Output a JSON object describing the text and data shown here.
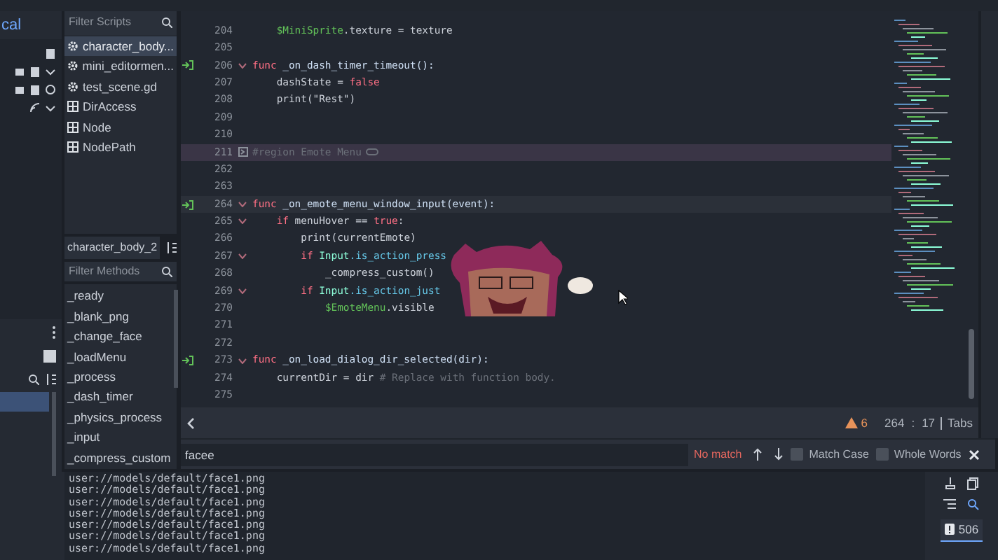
{
  "left_dock": {
    "tab": "cal"
  },
  "scripts": {
    "filter_placeholder": "Filter Scripts",
    "items": [
      {
        "name": "character_body...",
        "kind": "script",
        "selected": true
      },
      {
        "name": "mini_editormen...",
        "kind": "script",
        "selected": false
      },
      {
        "name": "test_scene.gd",
        "kind": "script",
        "selected": false
      },
      {
        "name": "DirAccess",
        "kind": "class",
        "selected": false
      },
      {
        "name": "Node",
        "kind": "class",
        "selected": false
      },
      {
        "name": "NodePath",
        "kind": "class",
        "selected": false
      }
    ]
  },
  "methods": {
    "title": "character_body_2",
    "filter_placeholder": "Filter Methods",
    "items": [
      "_ready",
      "_blank_png",
      "_change_face",
      "_loadMenu",
      "_process",
      "_dash_timer",
      "_physics_process",
      "_input",
      "_compress_custom"
    ]
  },
  "code_lines": [
    {
      "number": "204",
      "kind": "normal",
      "signal": false,
      "fold": false,
      "segments": [
        {
          "text": "\t$MiniSprite",
          "kind": "node"
        },
        {
          "text": ".texture = texture",
          "kind": "plain"
        }
      ]
    },
    {
      "number": "205",
      "kind": "normal",
      "signal": false,
      "fold": false
    },
    {
      "number": "206",
      "kind": "normal",
      "signal": true,
      "fold": true,
      "segments": [
        {
          "text": "func",
          "kind": "kw"
        },
        {
          "text": " _on_dash_timer_timeout():",
          "kind": "fn"
        }
      ]
    },
    {
      "number": "207",
      "kind": "normal",
      "signal": false,
      "fold": false,
      "segments": [
        {
          "text": "\tdashState = ",
          "kind": "plain"
        },
        {
          "text": "false",
          "kind": "kw"
        }
      ]
    },
    {
      "number": "208",
      "kind": "normal",
      "signal": false,
      "fold": false,
      "segments": [
        {
          "text": "\tprint(\"Rest\")",
          "kind": "plain"
        }
      ]
    },
    {
      "number": "209",
      "kind": "normal",
      "signal": false,
      "fold": false
    },
    {
      "number": "210",
      "kind": "normal",
      "signal": false,
      "fold": false
    },
    {
      "number": "211",
      "kind": "region",
      "signal": false,
      "fold": false,
      "segments": [
        {
          "text": "#region Emote Menu",
          "kind": "comment"
        }
      ]
    },
    {
      "number": "262",
      "kind": "normal",
      "signal": false,
      "fold": false
    },
    {
      "number": "263",
      "kind": "normal",
      "signal": false,
      "fold": false
    },
    {
      "number": "264",
      "kind": "current",
      "signal": true,
      "fold": true,
      "segments": [
        {
          "text": "func",
          "kind": "kw"
        },
        {
          "text": " _on_emote_menu_window_input(event):",
          "kind": "fn"
        }
      ]
    },
    {
      "number": "265",
      "kind": "normal",
      "signal": false,
      "fold": true,
      "segments": [
        {
          "text": "\tif",
          "kind": "kw"
        },
        {
          "text": " menuHover == ",
          "kind": "plain"
        },
        {
          "text": "true",
          "kind": "kw"
        },
        {
          "text": ":",
          "kind": "plain"
        }
      ]
    },
    {
      "number": "266",
      "kind": "normal",
      "signal": false,
      "fold": false,
      "segments": [
        {
          "text": "\t\tprint(currentEmote)",
          "kind": "plain"
        }
      ]
    },
    {
      "number": "267",
      "kind": "normal",
      "signal": false,
      "fold": true,
      "segments": [
        {
          "text": "\t\tif",
          "kind": "kw"
        },
        {
          "text": " Input",
          "kind": "cls"
        },
        {
          "text": ".is_action_press",
          "kind": "method"
        }
      ]
    },
    {
      "number": "268",
      "kind": "normal",
      "signal": false,
      "fold": false,
      "segments": [
        {
          "text": "\t\t\t_compress_custom()",
          "kind": "plain"
        }
      ]
    },
    {
      "number": "269",
      "kind": "normal",
      "signal": false,
      "fold": true,
      "segments": [
        {
          "text": "\t\tif",
          "kind": "kw"
        },
        {
          "text": " Input",
          "kind": "cls"
        },
        {
          "text": ".is_action_just",
          "kind": "method"
        }
      ]
    },
    {
      "number": "270",
      "kind": "normal",
      "signal": false,
      "fold": false,
      "segments": [
        {
          "text": "\t\t\t$EmoteMenu",
          "kind": "node"
        },
        {
          "text": ".visible",
          "kind": "plain"
        }
      ]
    },
    {
      "number": "271",
      "kind": "normal",
      "signal": false,
      "fold": false
    },
    {
      "number": "272",
      "kind": "normal",
      "signal": false,
      "fold": false
    },
    {
      "number": "273",
      "kind": "normal",
      "signal": true,
      "fold": true,
      "segments": [
        {
          "text": "func",
          "kind": "kw"
        },
        {
          "text": " _on_load_dialog_dir_selected(dir):",
          "kind": "fn"
        }
      ]
    },
    {
      "number": "274",
      "kind": "normal",
      "signal": false,
      "fold": false,
      "segments": [
        {
          "text": "\tcurrentDir = dir ",
          "kind": "plain"
        },
        {
          "text": "# Replace with function body.",
          "kind": "comment"
        }
      ]
    },
    {
      "number": "275",
      "kind": "normal",
      "signal": false,
      "fold": false
    }
  ],
  "status_bar": {
    "warnings": "6",
    "line": "264",
    "separator": ":",
    "column": "17",
    "indent_mode": "Tabs"
  },
  "find_bar": {
    "value": "facee",
    "result": "No match",
    "options": [
      {
        "label": "Match Case",
        "checked": false
      },
      {
        "label": "Whole Words",
        "checked": false
      }
    ]
  },
  "output": {
    "lines": [
      "user://models/default/face1.png",
      "user://models/default/face1.png",
      "user://models/default/face1.png",
      "user://models/default/face1.png",
      "user://models/default/face1.png",
      "user://models/default/face1.png",
      "user://models/default/face1.png"
    ],
    "error_count": "506"
  }
}
